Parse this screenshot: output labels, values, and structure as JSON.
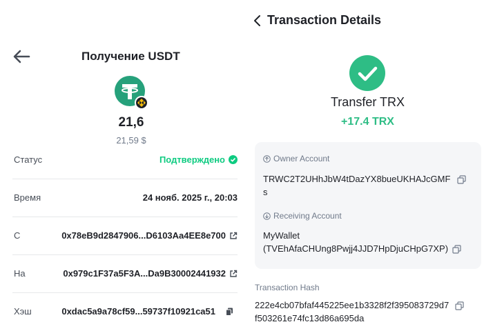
{
  "left": {
    "title": "Получение USDT",
    "amount": "21,6",
    "amount_fiat": "21,59 $",
    "rows": [
      {
        "label": "Статус",
        "value": "Подтверждено"
      },
      {
        "label": "Время",
        "value": "24 нояб. 2025 г., 20:03"
      },
      {
        "label": "С",
        "value": "0x78eB9d2847906...D6103Aa4EE8e700"
      },
      {
        "label": "На",
        "value": "0x979c1F37a5F3A...Da9B30002441932"
      },
      {
        "label": "Хэш",
        "value": "0xdac5a9a78cf59...59737f10921ca51"
      }
    ]
  },
  "right": {
    "title": "Transaction Details",
    "type": "Transfer TRX",
    "amount": "+17.4 TRX",
    "owner_label": "Owner Account",
    "owner_value_line1": "TRWC2T2UHhJbW4tDazYX8bueUKHAJcGMF",
    "owner_value_line2": "s",
    "receiving_label": "Receiving Account",
    "receiving_name": "MyWallet",
    "receiving_address": "(TVEhAfaCHUng8Pwjj4JJD7HpDjuCHpG7XP)",
    "hash_label": "Transaction Hash",
    "hash_line1": "222e4cb07bfaf445225ee1b3328f2f395083729d7",
    "hash_line2": "f503261e74fc13d86a695da"
  },
  "colors": {
    "tether": "#26a17b",
    "success_green": "#0ecb81",
    "trx_green": "#2ebd85"
  }
}
